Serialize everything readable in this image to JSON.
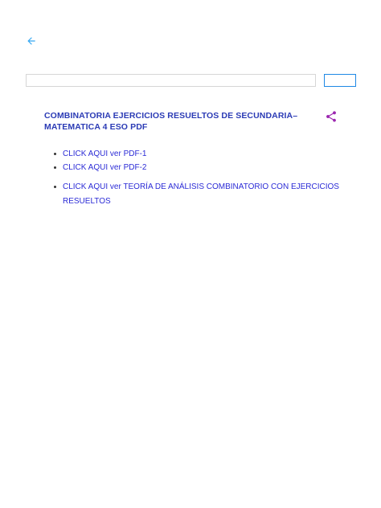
{
  "header": {
    "back_icon": "arrow-left-icon"
  },
  "search": {
    "value": "",
    "placeholder": "",
    "button_label": ""
  },
  "post": {
    "title": "COMBINATORIA EJERCICIOS RESUELTOS DE SECUNDARIA–MATEMATICA 4 ESO PDF",
    "share_icon": "share-icon",
    "links": [
      {
        "label": "CLICK AQUI ver PDF-1"
      },
      {
        "label": "CLICK AQUI ver PDF-2"
      }
    ],
    "theory_links": [
      {
        "label": "CLICK AQUI ver TEORÍA DE ANÁLISIS COMBINATORIO CON EJERCICIOS RESUELTOS"
      }
    ]
  },
  "colors": {
    "back_arrow": "#35a7f2",
    "search_button_border": "#1e88e5",
    "title": "#2b3bb5",
    "link": "#2b2bd6",
    "share_icon": "#9c27b0"
  }
}
